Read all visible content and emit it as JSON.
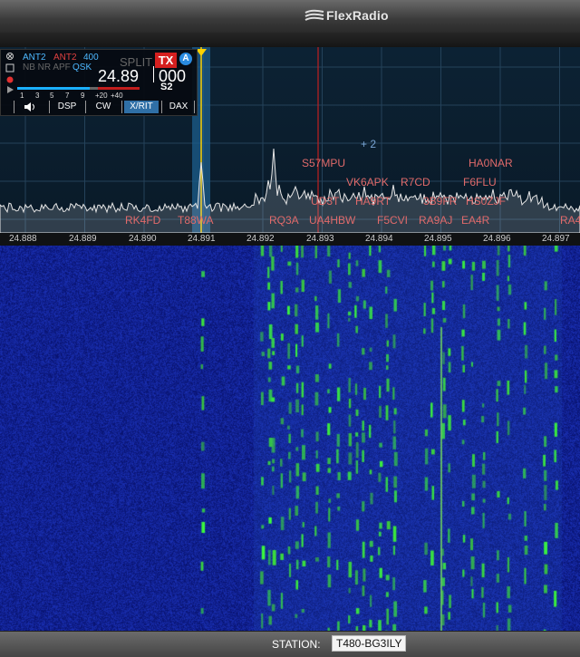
{
  "app": {
    "title": "FlexRadio"
  },
  "slice": {
    "ant_rx": "ANT2",
    "ant_tx": "ANT2",
    "bandwidth": "400",
    "flags": "NB NR APF",
    "qsk": "QSK",
    "split_label": "SPLIT",
    "tx_badge": "TX",
    "slice_letter": "A",
    "frequency": "24.89",
    "frequency_sub": "000",
    "smeter_scale": [
      "1",
      "3",
      "5",
      "7",
      "9",
      "+20",
      "+40"
    ],
    "smeter_reading": "S2",
    "tabs": [
      "DSP",
      "CW",
      "X/RIT",
      "DAX"
    ]
  },
  "spots": {
    "cluster_badge": "+ 2",
    "labels": [
      "S57MPU",
      "HA0NAR",
      "VK6APK",
      "R7CD",
      "F6FLU",
      "UD3T",
      "HA9RT",
      "3B9FR",
      "HS0ZJF",
      "RK4FD",
      "T88WA",
      "RQ3A",
      "UA4HBW",
      "F5CVI",
      "RA9AJ",
      "EA4R",
      "RA4"
    ]
  },
  "freq_scale": [
    "24.888",
    "24.889",
    "24.890",
    "24.891",
    "24.892",
    "24.893",
    "24.894",
    "24.895",
    "24.896",
    "24.897"
  ],
  "footer": {
    "station_label": "STATION:",
    "station_value": "T480-BG3ILY"
  },
  "colors": {
    "spot": "#e06a6a",
    "waterfall_bg": "#0b1a8c",
    "signal": "#2ee82e",
    "tx_red": "#e02020"
  }
}
